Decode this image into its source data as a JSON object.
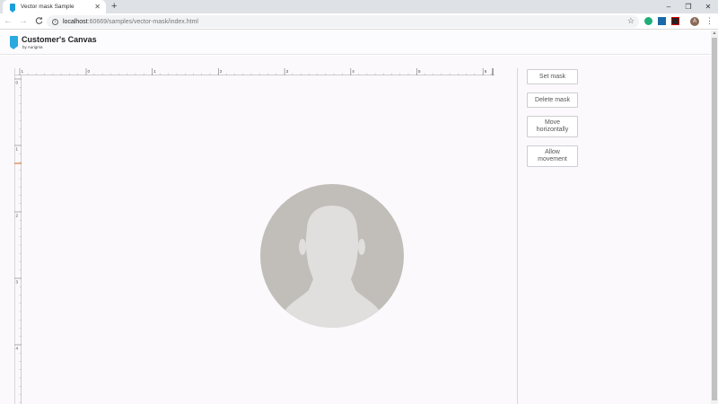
{
  "browser": {
    "tab_title": "Vector mask Sample",
    "tab_close": "✕",
    "new_tab": "+",
    "window_controls": [
      "–",
      "❐",
      "✕"
    ],
    "nav_back": "←",
    "nav_forward": "→",
    "nav_reload": "C",
    "url_host": "localhost",
    "url_rest": ":60669/samples/vector-mask/index.html",
    "info_glyph": "i",
    "star": "☆",
    "avatar_letter": "A",
    "menu": "⋮",
    "colors": {
      "tabbar": "#dee1e6",
      "omnibox": "#f1f3f4"
    }
  },
  "app": {
    "title": "Customer's Canvas",
    "subtitle": "by Aurigma",
    "brand_color": "#29a9e0"
  },
  "ruler": {
    "top_labels": [
      "1",
      "0",
      "1",
      "2",
      "3",
      "4",
      "5",
      "6"
    ],
    "left_labels": [
      "0",
      "1",
      "2",
      "3",
      "4"
    ]
  },
  "buttons": {
    "set_mask": "Set mask",
    "delete_mask": "Delete mask",
    "move_horizontally": "Move horizontally",
    "allow_movement": "Allow movement"
  },
  "canvas": {
    "image_icon": "person-placeholder-icon",
    "colors": {
      "circle": "#c1beb9",
      "silhouette": "#e0dfdd",
      "background": "#fbf9fc"
    }
  }
}
